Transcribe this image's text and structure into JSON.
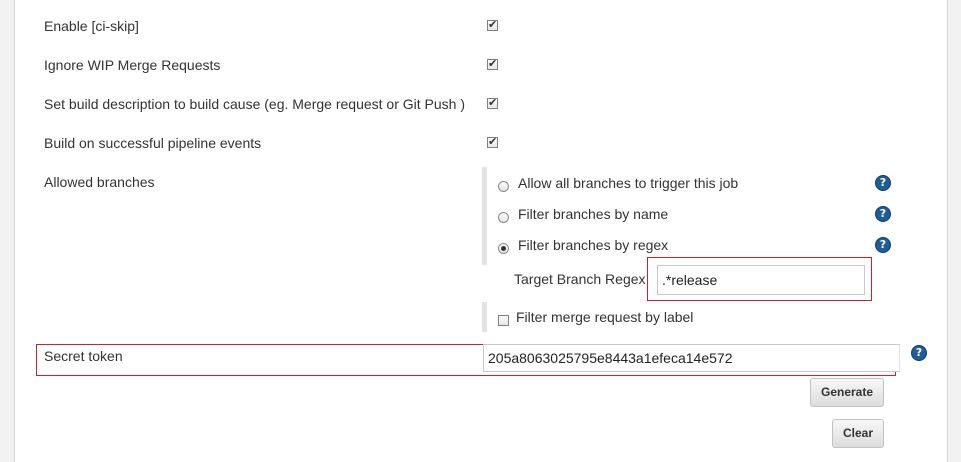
{
  "options": {
    "ci_skip": {
      "label": "Enable [ci-skip]",
      "checked": true
    },
    "ignore_wip": {
      "label": "Ignore WIP Merge Requests",
      "checked": true
    },
    "build_description": {
      "label": "Set build description to build cause (eg. Merge request or Git Push )",
      "checked": true
    },
    "pipeline_events": {
      "label": "Build on successful pipeline events",
      "checked": true
    }
  },
  "allowed_branches": {
    "label": "Allowed branches",
    "choices": [
      {
        "label": "Allow all branches to trigger this job",
        "selected": false
      },
      {
        "label": "Filter branches by name",
        "selected": false
      },
      {
        "label": "Filter branches by regex",
        "selected": true
      }
    ],
    "target_regex_label": "Target Branch Regex",
    "target_regex_value": ".*release",
    "label_filter": {
      "label": "Filter merge request by label",
      "checked": false
    }
  },
  "secret_token": {
    "label": "Secret token",
    "value": "205a8063025795e8443a1efeca14e572"
  },
  "buttons": {
    "generate": "Generate",
    "clear": "Clear"
  },
  "colors": {
    "highlight": "#c8242b",
    "help_icon": "#1e5c9a"
  }
}
